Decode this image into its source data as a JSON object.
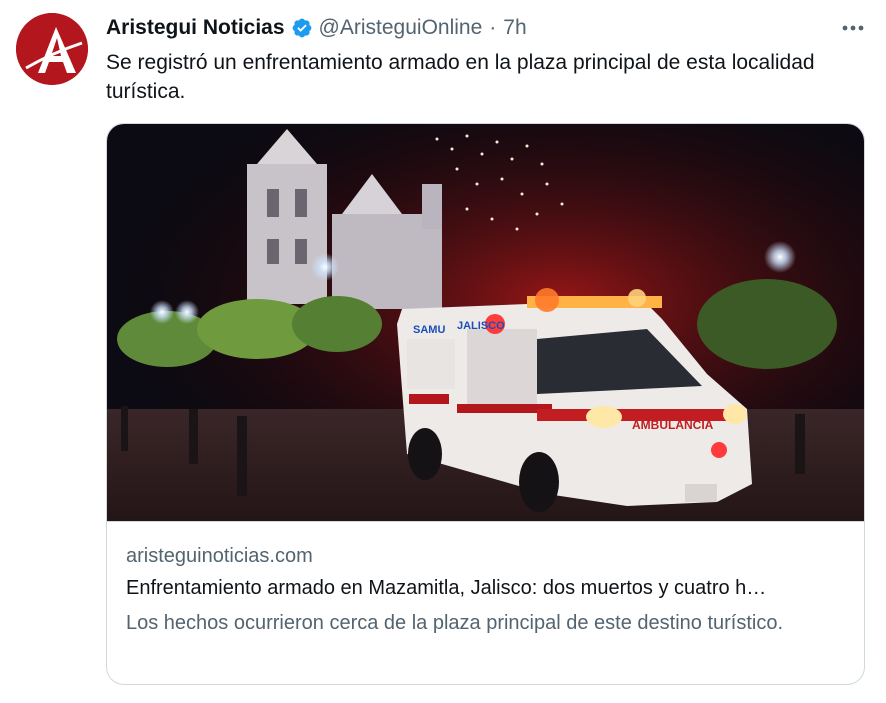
{
  "account": {
    "display_name": "Aristegui Noticias",
    "handle": "@AristeguiOnline",
    "separator": "·",
    "time": "7h",
    "avatar_letter": "A",
    "verified": true
  },
  "tweet": {
    "text": "Se registró un enfrentamiento armado en la plaza principal de esta localidad turística."
  },
  "card": {
    "domain": "aristeguinoticias.com",
    "title": "Enfrentamiento armado en Mazamitla, Jalisco: dos muertos y cuatro h…",
    "description": "Los hechos ocurrieron cerca de la plaza principal de este destino turístico.",
    "image_text": {
      "samu": "SAMU",
      "jalisco": "JALISCO",
      "ambulancia": "AMBULANCIA"
    }
  },
  "icons": {
    "verified": "verified-badge-icon",
    "more": "more-options-icon"
  },
  "colors": {
    "avatar_bg": "#b3161d",
    "verified_blue": "#1d9bf0",
    "secondary_text": "#536471",
    "primary_text": "#0f1419",
    "border": "#cfd9de"
  }
}
